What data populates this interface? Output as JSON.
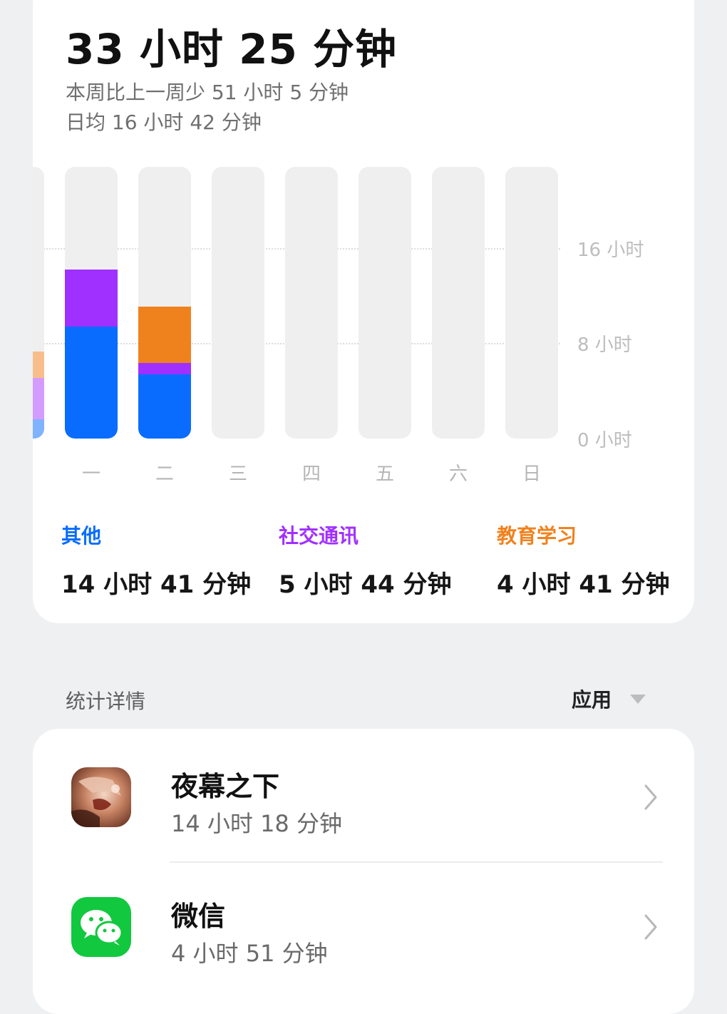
{
  "summary": {
    "total": "33 小时 25 分钟",
    "compare": "本周比上一周少 51 小时 5 分钟",
    "daily_avg": "日均 16 小时 42 分钟"
  },
  "chart_data": {
    "type": "bar",
    "stacked": true,
    "categories": [
      "一",
      "二",
      "三",
      "四",
      "五",
      "六",
      "日"
    ],
    "y_unit": "小时",
    "y_ticks": [
      "16 小时",
      "8 小时",
      "0 小时"
    ],
    "ylim": [
      0,
      22.8
    ],
    "colors": {
      "其他": "#0a6cff",
      "社交通讯": "#a030ff",
      "教育学习": "#f0821e"
    },
    "series": [
      {
        "name": "其他",
        "color": "#0a6cff",
        "values": [
          9.4,
          5.4,
          0,
          0,
          0,
          0,
          0
        ]
      },
      {
        "name": "社交通讯",
        "color": "#a030ff",
        "values": [
          4.8,
          0.95,
          0,
          0,
          0,
          0,
          0
        ]
      },
      {
        "name": "教育学习",
        "color": "#f0821e",
        "values": [
          0,
          4.7,
          0,
          0,
          0,
          0,
          0
        ]
      }
    ],
    "partial_prev_bar": {
      "values_bottom_up": [
        1.6,
        3.5,
        2.2
      ],
      "colors": [
        "#7fb3ff",
        "#d59cff",
        "#f7be8c"
      ]
    }
  },
  "legend": [
    {
      "name": "其他",
      "time": "14 小时 41 分钟",
      "color": "#0a6cff"
    },
    {
      "name": "社交通讯",
      "time": "5 小时 44 分钟",
      "color": "#a030ff"
    },
    {
      "name": "教育学习",
      "time": "4 小时 41 分钟",
      "color": "#f0821e"
    }
  ],
  "details": {
    "title": "统计详情",
    "sort_label": "应用"
  },
  "apps": [
    {
      "name": "夜幕之下",
      "time": "14 小时 18 分钟",
      "icon": "game-app-icon"
    },
    {
      "name": "微信",
      "time": "4 小时 51 分钟",
      "icon": "wechat-icon"
    }
  ]
}
